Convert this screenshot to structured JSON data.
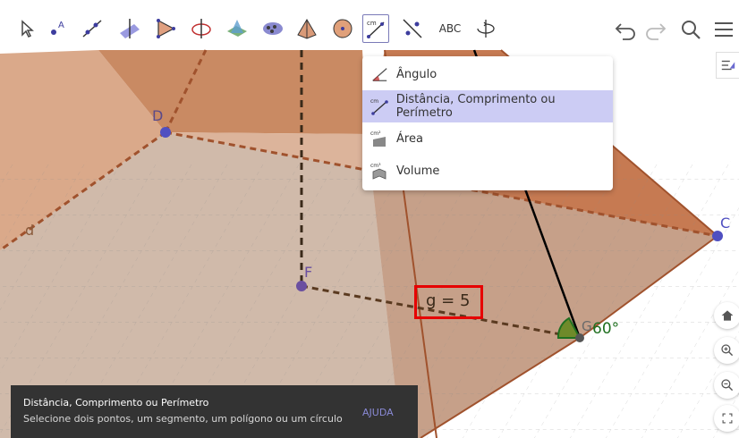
{
  "toolbar": {
    "tools": [
      {
        "name": "move-tool-icon"
      },
      {
        "name": "point-tool-icon"
      },
      {
        "name": "line-tool-icon"
      },
      {
        "name": "perpendicular-line-tool-icon"
      },
      {
        "name": "polygon-tool-icon"
      },
      {
        "name": "circle-axis-tool-icon"
      },
      {
        "name": "intersect-surfaces-tool-icon"
      },
      {
        "name": "plane-tool-icon"
      },
      {
        "name": "pyramid-tool-icon"
      },
      {
        "name": "sphere-tool-icon"
      },
      {
        "name": "measure-tool-icon"
      },
      {
        "name": "reflect-tool-icon"
      },
      {
        "name": "text-tool-icon",
        "label": "ABC"
      },
      {
        "name": "rotate-view-tool-icon"
      }
    ],
    "measure_icon_unit": "cm",
    "undo_label": "undo",
    "redo_label": "redo"
  },
  "menu": {
    "items": [
      {
        "label": "Ângulo",
        "icon": "angle-icon",
        "selected": false
      },
      {
        "label": "Distância, Comprimento ou Perímetro",
        "icon": "distance-icon",
        "unit": "cm",
        "selected": true
      },
      {
        "label": "Área",
        "icon": "area-icon",
        "unit": "cm²",
        "selected": false
      },
      {
        "label": "Volume",
        "icon": "volume-icon",
        "unit": "cm³",
        "selected": false
      }
    ]
  },
  "scene": {
    "points": [
      {
        "label": "D"
      },
      {
        "label": "C"
      },
      {
        "label": "F"
      }
    ],
    "edge_label_d": "d",
    "angle_label": "60°",
    "angle_point_label": "G",
    "measurement": "g = 5",
    "colors": {
      "pyramid_face": "#c9885e",
      "pyramid_edge": "#a0522d",
      "point": "#4f4fc1",
      "angle": "#207020",
      "highlight_box": "#e60000"
    }
  },
  "toast": {
    "title": "Distância, Comprimento ou Perímetro",
    "subtitle": "Selecione dois pontos, um segmento, um polígono ou um círculo",
    "help": "AJUDA"
  },
  "sidebar_buttons": [
    {
      "name": "home-icon"
    },
    {
      "name": "zoom-in-icon"
    },
    {
      "name": "zoom-out-icon"
    },
    {
      "name": "fullscreen-icon"
    }
  ]
}
